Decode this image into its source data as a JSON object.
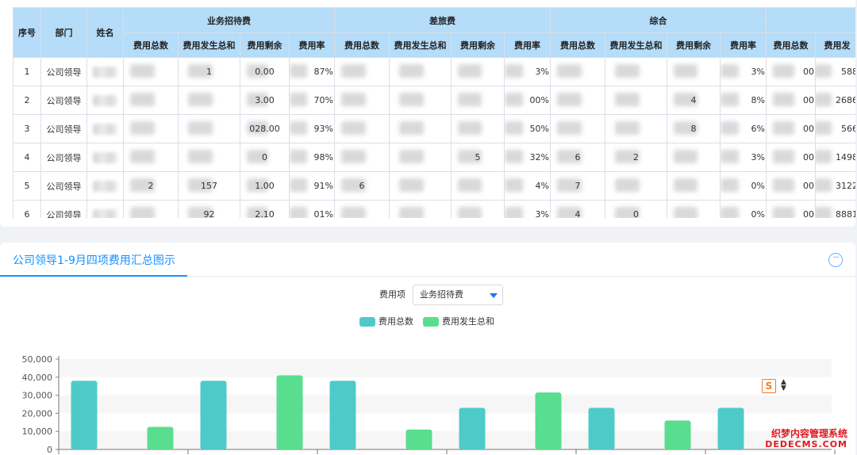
{
  "table": {
    "headers": {
      "index": "序号",
      "dept": "部门",
      "name": "姓名",
      "groups": [
        "业务招待费",
        "差旅费",
        "综合"
      ],
      "sub": [
        "费用总数",
        "费用发生总和",
        "费用剩余",
        "费用率"
      ],
      "extra_sub": [
        "费用总数",
        "费用发"
      ]
    },
    "rows": [
      {
        "idx": "1",
        "dept": "公司领导",
        "g1": [
          "",
          "1",
          "0.00",
          "87%"
        ],
        "g2": [
          "",
          "",
          "",
          "3%"
        ],
        "g3": [
          "",
          "",
          "",
          "3%"
        ],
        "x": [
          "00",
          "588"
        ]
      },
      {
        "idx": "2",
        "dept": "公司领导",
        "g1": [
          "",
          "",
          "3.00",
          "70%"
        ],
        "g2": [
          "",
          "",
          "",
          "00%"
        ],
        "g3": [
          "",
          "",
          "4",
          "8%"
        ],
        "x": [
          "00",
          "2686"
        ]
      },
      {
        "idx": "3",
        "dept": "公司领导",
        "g1": [
          "",
          "",
          "028.00",
          "93%"
        ],
        "g2": [
          "",
          "",
          "",
          "50%"
        ],
        "g3": [
          "",
          "",
          "8",
          "6%"
        ],
        "x": [
          "00",
          "566"
        ]
      },
      {
        "idx": "4",
        "dept": "公司领导",
        "g1": [
          "",
          "",
          "0",
          "98%"
        ],
        "g2": [
          "",
          "",
          "5",
          "32%"
        ],
        "g3": [
          "6",
          "2",
          "",
          "3%"
        ],
        "x": [
          "00",
          "1498"
        ]
      },
      {
        "idx": "5",
        "dept": "公司领导",
        "g1": [
          "2",
          "157",
          "1.00",
          "91%"
        ],
        "g2": [
          "6",
          "",
          "",
          "4%"
        ],
        "g3": [
          "7",
          "",
          "",
          "0%"
        ],
        "x": [
          "00",
          "3122"
        ]
      },
      {
        "idx": "6",
        "dept": "公司领导",
        "g1": [
          "",
          "92",
          "2.10",
          "01%"
        ],
        "g2": [
          "",
          "",
          "",
          "3%"
        ],
        "g3": [
          "4",
          "0",
          "",
          "0%"
        ],
        "x": [
          "00",
          "8881"
        ]
      }
    ]
  },
  "chart_panel": {
    "tab_title": "公司领导1-9月四项费用汇总图示",
    "more_icon": "ellipsis-circle-icon",
    "filter_label": "费用项",
    "filter_value": "业务招待费",
    "tool_icon": "s-logo-icon",
    "watermark_cn": "织梦内容管理系统",
    "watermark_en": "DEDECMS.COM"
  },
  "chart_data": {
    "type": "bar",
    "series": [
      {
        "name": "费用总数",
        "color": "#4ecbc8",
        "points": [
          [
            0,
            38000
          ],
          [
            1,
            38000
          ],
          [
            2,
            38000
          ],
          [
            3,
            23000
          ],
          [
            4,
            23000
          ],
          [
            5,
            23000
          ]
        ]
      },
      {
        "name": "费用发生总和",
        "color": "#58de8e",
        "points": [
          [
            0,
            12500
          ],
          [
            1,
            41000
          ],
          [
            2,
            11000
          ],
          [
            3,
            31500
          ],
          [
            4,
            16000
          ]
        ]
      }
    ],
    "y_ticks": [
      "0",
      "10,000",
      "20,000",
      "30,000",
      "40,000",
      "50,000"
    ],
    "ylim": [
      0,
      50000
    ],
    "grid": true,
    "legend_position": "top-center"
  }
}
